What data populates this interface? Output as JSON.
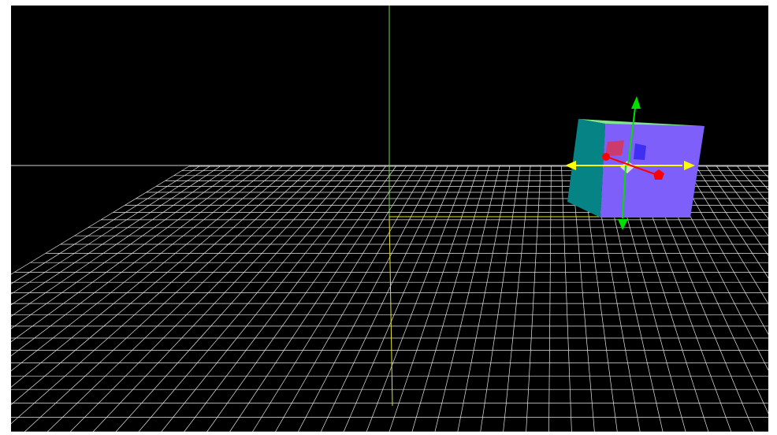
{
  "viewport": {
    "background_color": "#000000",
    "grid_color": "#e6e6e6",
    "horizon_color": "#cfcfcf",
    "vertical_axis_color": "#7cd84b",
    "ground_axis_color": "#e4e42a"
  },
  "selected_object": {
    "type": "cube",
    "colors": {
      "front_face": "#7f5ffa",
      "left_face": "#058385",
      "top_face": "#7de78e",
      "rotate_handle_red": "#cc3b6e",
      "rotate_handle_blue": "#3e2ff2"
    }
  },
  "transform_gizmo": {
    "x_axis_color": "#ff0000",
    "y_axis_color": "#00e000",
    "z_axis_color": "#ffff00",
    "center_color": "#d8d8d8"
  }
}
